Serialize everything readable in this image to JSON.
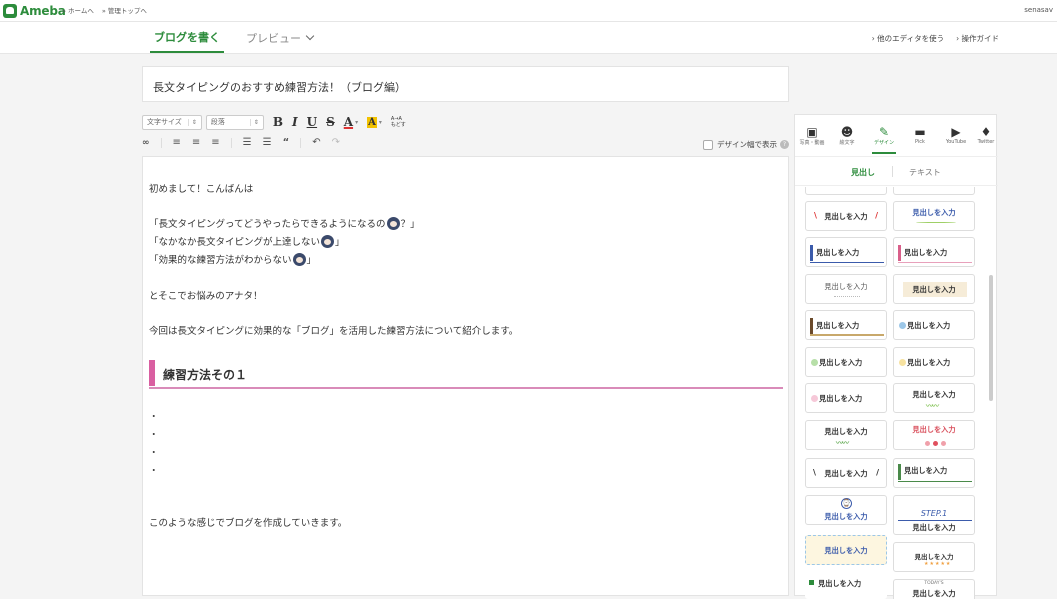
{
  "header": {
    "logo": "Ameba",
    "nav": [
      "» ホームへ",
      "» 管理トップへ"
    ],
    "username": "senasav"
  },
  "editor_tabs": {
    "write": "ブログを書く",
    "preview": "プレビュー",
    "other_editor": "› 他のエディタを使う",
    "guide": "› 操作ガイド"
  },
  "title": "長文タイピングのおすすめ練習方法！（ブログ編）",
  "toolbar": {
    "font_size": "文字サイズ",
    "paragraph": "段落",
    "bold": "B",
    "italic": "I",
    "underline": "U",
    "strike": "S",
    "font_color": "A",
    "bg_color": "A",
    "ruby": "A→A もどす",
    "design_width": "デザイン幅で表示"
  },
  "body": {
    "lines": [
      "初めまして！こんばんは",
      "「長文タイピングってどうやったらできるようになるの",
      "？」",
      "「なかなか長文タイピングが上達しない",
      "」",
      "「効果的な練習方法がわからない",
      "」",
      "とそこでお悩みのアナタ！",
      "今回は長文タイピングに効果的な「ブログ」を活用した練習方法について紹介します。",
      "このような感じでブログを作成していきます。"
    ],
    "heading": "練習方法その１",
    "bullet": "・"
  },
  "panel": {
    "tabs": [
      "写真・動画",
      "絵文字",
      "デザイン",
      "Pick",
      "YouTube",
      "Twitter"
    ],
    "subtab_heading": "見出し",
    "subtab_text": "テキスト",
    "card_label": "見出しを入力",
    "step_label": "STEP.1",
    "today_label": "TODAY'S"
  },
  "colors": {
    "brand": "#2d8c3c",
    "heading_accent": "#d95fa1"
  }
}
